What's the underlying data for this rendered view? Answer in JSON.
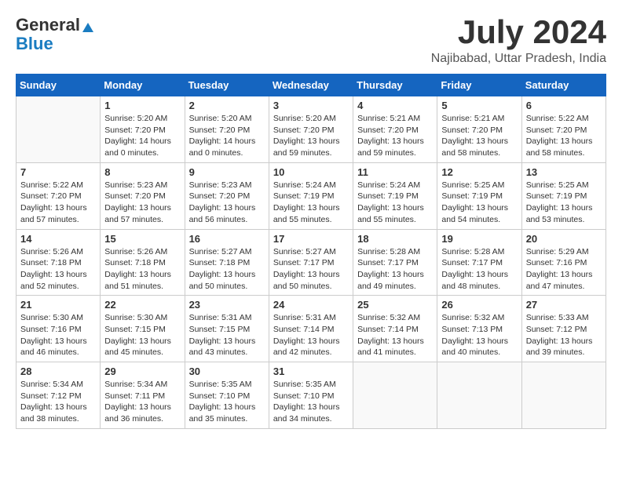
{
  "logo": {
    "general": "General",
    "blue": "Blue"
  },
  "title": "July 2024",
  "location": "Najibabad, Uttar Pradesh, India",
  "days_of_week": [
    "Sunday",
    "Monday",
    "Tuesday",
    "Wednesday",
    "Thursday",
    "Friday",
    "Saturday"
  ],
  "weeks": [
    [
      {
        "day": "",
        "info": ""
      },
      {
        "day": "1",
        "info": "Sunrise: 5:20 AM\nSunset: 7:20 PM\nDaylight: 14 hours\nand 0 minutes."
      },
      {
        "day": "2",
        "info": "Sunrise: 5:20 AM\nSunset: 7:20 PM\nDaylight: 14 hours\nand 0 minutes."
      },
      {
        "day": "3",
        "info": "Sunrise: 5:20 AM\nSunset: 7:20 PM\nDaylight: 13 hours\nand 59 minutes."
      },
      {
        "day": "4",
        "info": "Sunrise: 5:21 AM\nSunset: 7:20 PM\nDaylight: 13 hours\nand 59 minutes."
      },
      {
        "day": "5",
        "info": "Sunrise: 5:21 AM\nSunset: 7:20 PM\nDaylight: 13 hours\nand 58 minutes."
      },
      {
        "day": "6",
        "info": "Sunrise: 5:22 AM\nSunset: 7:20 PM\nDaylight: 13 hours\nand 58 minutes."
      }
    ],
    [
      {
        "day": "7",
        "info": "Sunrise: 5:22 AM\nSunset: 7:20 PM\nDaylight: 13 hours\nand 57 minutes."
      },
      {
        "day": "8",
        "info": "Sunrise: 5:23 AM\nSunset: 7:20 PM\nDaylight: 13 hours\nand 57 minutes."
      },
      {
        "day": "9",
        "info": "Sunrise: 5:23 AM\nSunset: 7:20 PM\nDaylight: 13 hours\nand 56 minutes."
      },
      {
        "day": "10",
        "info": "Sunrise: 5:24 AM\nSunset: 7:19 PM\nDaylight: 13 hours\nand 55 minutes."
      },
      {
        "day": "11",
        "info": "Sunrise: 5:24 AM\nSunset: 7:19 PM\nDaylight: 13 hours\nand 55 minutes."
      },
      {
        "day": "12",
        "info": "Sunrise: 5:25 AM\nSunset: 7:19 PM\nDaylight: 13 hours\nand 54 minutes."
      },
      {
        "day": "13",
        "info": "Sunrise: 5:25 AM\nSunset: 7:19 PM\nDaylight: 13 hours\nand 53 minutes."
      }
    ],
    [
      {
        "day": "14",
        "info": "Sunrise: 5:26 AM\nSunset: 7:18 PM\nDaylight: 13 hours\nand 52 minutes."
      },
      {
        "day": "15",
        "info": "Sunrise: 5:26 AM\nSunset: 7:18 PM\nDaylight: 13 hours\nand 51 minutes."
      },
      {
        "day": "16",
        "info": "Sunrise: 5:27 AM\nSunset: 7:18 PM\nDaylight: 13 hours\nand 50 minutes."
      },
      {
        "day": "17",
        "info": "Sunrise: 5:27 AM\nSunset: 7:17 PM\nDaylight: 13 hours\nand 50 minutes."
      },
      {
        "day": "18",
        "info": "Sunrise: 5:28 AM\nSunset: 7:17 PM\nDaylight: 13 hours\nand 49 minutes."
      },
      {
        "day": "19",
        "info": "Sunrise: 5:28 AM\nSunset: 7:17 PM\nDaylight: 13 hours\nand 48 minutes."
      },
      {
        "day": "20",
        "info": "Sunrise: 5:29 AM\nSunset: 7:16 PM\nDaylight: 13 hours\nand 47 minutes."
      }
    ],
    [
      {
        "day": "21",
        "info": "Sunrise: 5:30 AM\nSunset: 7:16 PM\nDaylight: 13 hours\nand 46 minutes."
      },
      {
        "day": "22",
        "info": "Sunrise: 5:30 AM\nSunset: 7:15 PM\nDaylight: 13 hours\nand 45 minutes."
      },
      {
        "day": "23",
        "info": "Sunrise: 5:31 AM\nSunset: 7:15 PM\nDaylight: 13 hours\nand 43 minutes."
      },
      {
        "day": "24",
        "info": "Sunrise: 5:31 AM\nSunset: 7:14 PM\nDaylight: 13 hours\nand 42 minutes."
      },
      {
        "day": "25",
        "info": "Sunrise: 5:32 AM\nSunset: 7:14 PM\nDaylight: 13 hours\nand 41 minutes."
      },
      {
        "day": "26",
        "info": "Sunrise: 5:32 AM\nSunset: 7:13 PM\nDaylight: 13 hours\nand 40 minutes."
      },
      {
        "day": "27",
        "info": "Sunrise: 5:33 AM\nSunset: 7:12 PM\nDaylight: 13 hours\nand 39 minutes."
      }
    ],
    [
      {
        "day": "28",
        "info": "Sunrise: 5:34 AM\nSunset: 7:12 PM\nDaylight: 13 hours\nand 38 minutes."
      },
      {
        "day": "29",
        "info": "Sunrise: 5:34 AM\nSunset: 7:11 PM\nDaylight: 13 hours\nand 36 minutes."
      },
      {
        "day": "30",
        "info": "Sunrise: 5:35 AM\nSunset: 7:10 PM\nDaylight: 13 hours\nand 35 minutes."
      },
      {
        "day": "31",
        "info": "Sunrise: 5:35 AM\nSunset: 7:10 PM\nDaylight: 13 hours\nand 34 minutes."
      },
      {
        "day": "",
        "info": ""
      },
      {
        "day": "",
        "info": ""
      },
      {
        "day": "",
        "info": ""
      }
    ]
  ]
}
